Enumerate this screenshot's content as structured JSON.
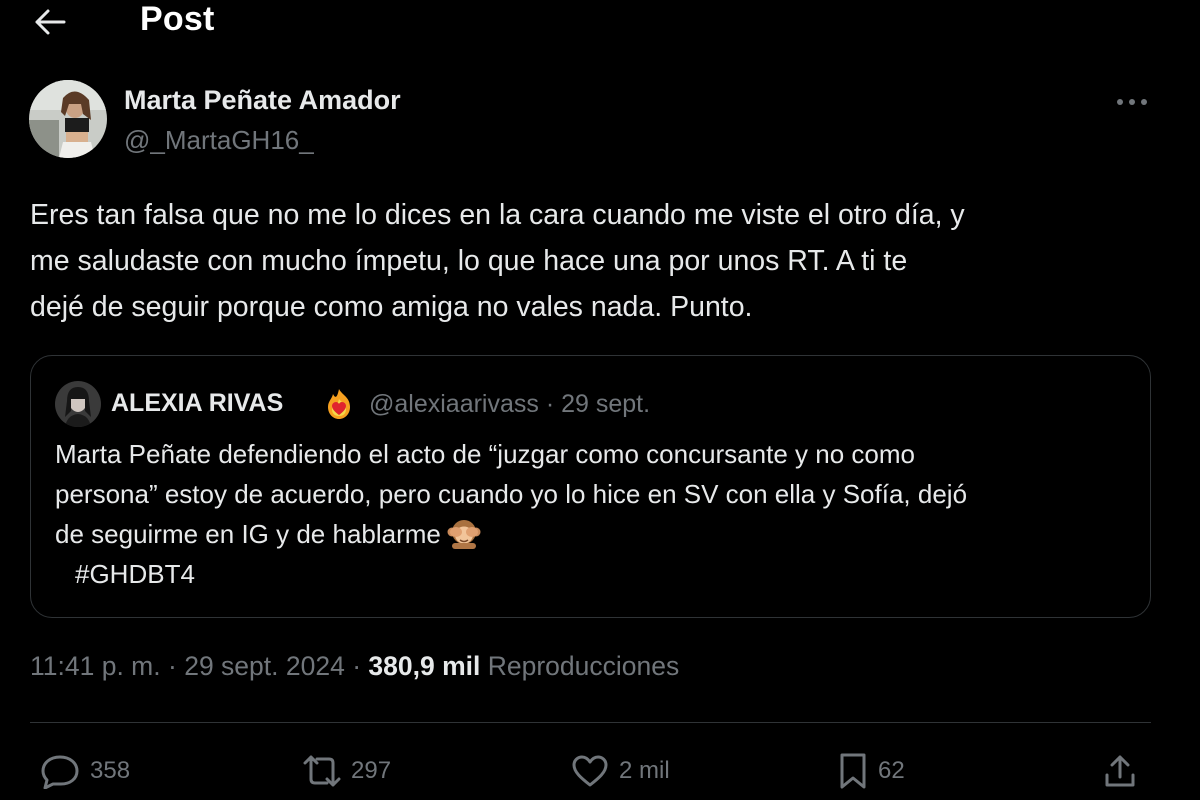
{
  "header": {
    "title": "Post",
    "back_icon": "arrow-left-icon"
  },
  "author": {
    "name": "Marta Peñate Amador",
    "handle": "@_MartaGH16_"
  },
  "post": {
    "lines": [
      "Eres tan falsa que no me lo dices en la cara cuando me viste el otro día, y",
      "me saludaste con mucho ímpetu, lo que hace una por unos RT. A ti te",
      "dejé de seguir porque como amiga no vales nada. Punto."
    ]
  },
  "quoted": {
    "name": "ALEXIA RIVAS",
    "badge_icon": "fire-heart-emoji",
    "handle": "@alexiaarivass",
    "separator": "·",
    "date": "29 sept.",
    "lines": [
      "Marta Peñate defendiendo el acto de “juzgar como concursante y no como",
      "persona” estoy de acuerdo, pero cuando yo lo hice en SV con ella y Sofía, dejó",
      "de seguirme en IG y de hablarme"
    ],
    "inline_emoji": "see-no-evil-monkey-emoji",
    "hashtag": "#GHDBT4"
  },
  "meta": {
    "time": "11:41 p. m.",
    "separator1": "·",
    "date": "29 sept. 2024",
    "separator2": "·",
    "views": "380,9 mil",
    "views_label": "Reproducciones"
  },
  "actions": {
    "replies": "358",
    "reposts": "297",
    "likes": "2 mil",
    "bookmarks": "62"
  },
  "colors": {
    "background": "#000000",
    "text": "#e7e9ea",
    "secondary": "#71767b",
    "border": "#2f3336"
  }
}
